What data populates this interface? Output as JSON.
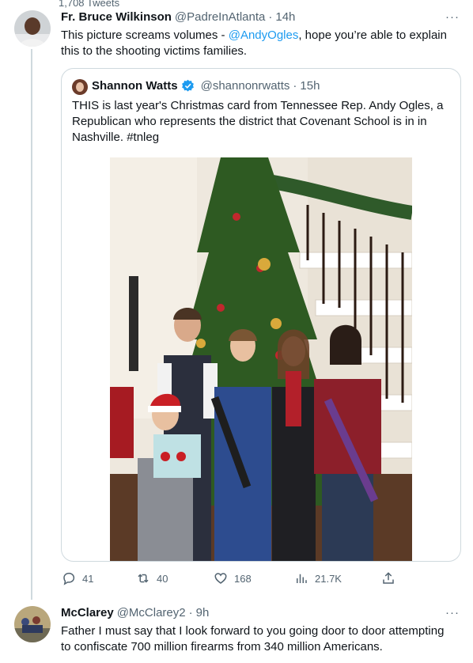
{
  "top_count": "1,708 Tweets",
  "tweet": {
    "name": "Fr. Bruce Wilkinson",
    "handle": "@PadreInAtlanta",
    "time": "14h",
    "text_before": "This picture screams volumes - ",
    "mention": "@AndyOgles",
    "text_after": ", hope you’re able to explain this to the shooting victims families.",
    "more": "···"
  },
  "quote": {
    "name": "Shannon Watts",
    "handle": "@shannonrwatts",
    "time": "15h",
    "text": "THIS is last year's Christmas card from Tennessee Rep. Andy Ogles, a Republican who represents the district that Covenant School is in in Nashville. #tnleg"
  },
  "actions": {
    "replies": "41",
    "retweets": "40",
    "likes": "168",
    "views": "21.7K"
  },
  "reply": {
    "name": "McClarey",
    "handle": "@McClarey2",
    "time": "9h",
    "text": "Father I must say that I look forward to you going door to door attempting to confiscate 700 million firearms from 340 million Americans.",
    "more": "···"
  },
  "colors": {
    "link": "#1d9bf0",
    "verified": "#1d9bf0",
    "muted": "#536471"
  }
}
